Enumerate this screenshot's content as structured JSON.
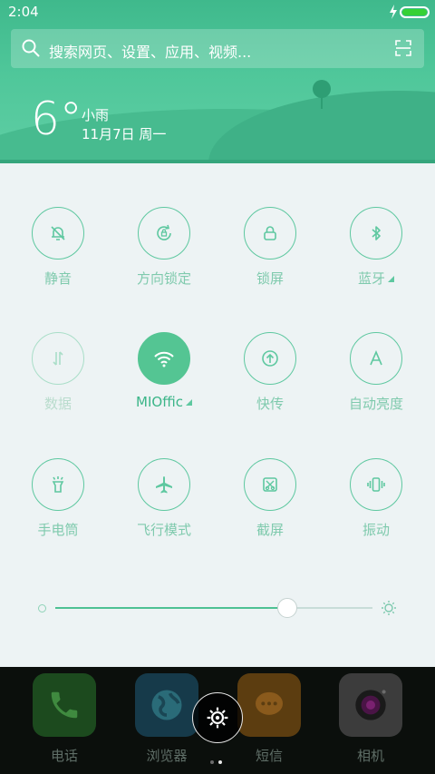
{
  "status_bar": {
    "time": "2:04",
    "battery_percent": 100
  },
  "search": {
    "placeholder": "搜索网页、设置、应用、视频..."
  },
  "weather": {
    "temperature": "6°",
    "condition": "小雨",
    "date": "11月7日 周一"
  },
  "toggles": [
    {
      "id": "mute",
      "label": "静音",
      "icon": "bell-off-icon",
      "state": "off"
    },
    {
      "id": "rotation-lock",
      "label": "方向锁定",
      "icon": "rotation-lock-icon",
      "state": "off"
    },
    {
      "id": "lock-screen",
      "label": "锁屏",
      "icon": "lock-icon",
      "state": "off"
    },
    {
      "id": "bluetooth",
      "label": "蓝牙",
      "icon": "bluetooth-icon",
      "state": "off",
      "has_submenu": true
    },
    {
      "id": "data",
      "label": "数据",
      "icon": "mobile-data-icon",
      "state": "disabled"
    },
    {
      "id": "wifi",
      "label": "MIOffic",
      "icon": "wifi-icon",
      "state": "on",
      "has_submenu": true
    },
    {
      "id": "quick-transfer",
      "label": "快传",
      "icon": "upload-icon",
      "state": "off"
    },
    {
      "id": "auto-brightness",
      "label": "自动亮度",
      "icon": "auto-brightness-icon",
      "state": "off"
    },
    {
      "id": "flashlight",
      "label": "手电筒",
      "icon": "flashlight-icon",
      "state": "off"
    },
    {
      "id": "airplane",
      "label": "飞行模式",
      "icon": "airplane-icon",
      "state": "off"
    },
    {
      "id": "screenshot",
      "label": "截屏",
      "icon": "screenshot-icon",
      "state": "off"
    },
    {
      "id": "vibrate",
      "label": "振动",
      "icon": "vibrate-icon",
      "state": "off"
    }
  ],
  "brightness": {
    "level_percent": 73
  },
  "dock": [
    {
      "label": "电话",
      "icon": "phone-icon"
    },
    {
      "label": "浏览器",
      "icon": "browser-icon"
    },
    {
      "label": "短信",
      "icon": "message-icon"
    },
    {
      "label": "相机",
      "icon": "camera-icon"
    }
  ],
  "colors": {
    "accent": "#54c593",
    "header": "#4fc79a",
    "panel_bg": "#edf3f4"
  },
  "center_button": {
    "icon": "settings-gear-icon"
  },
  "page_indicator": {
    "pages": 2,
    "current": 2
  }
}
